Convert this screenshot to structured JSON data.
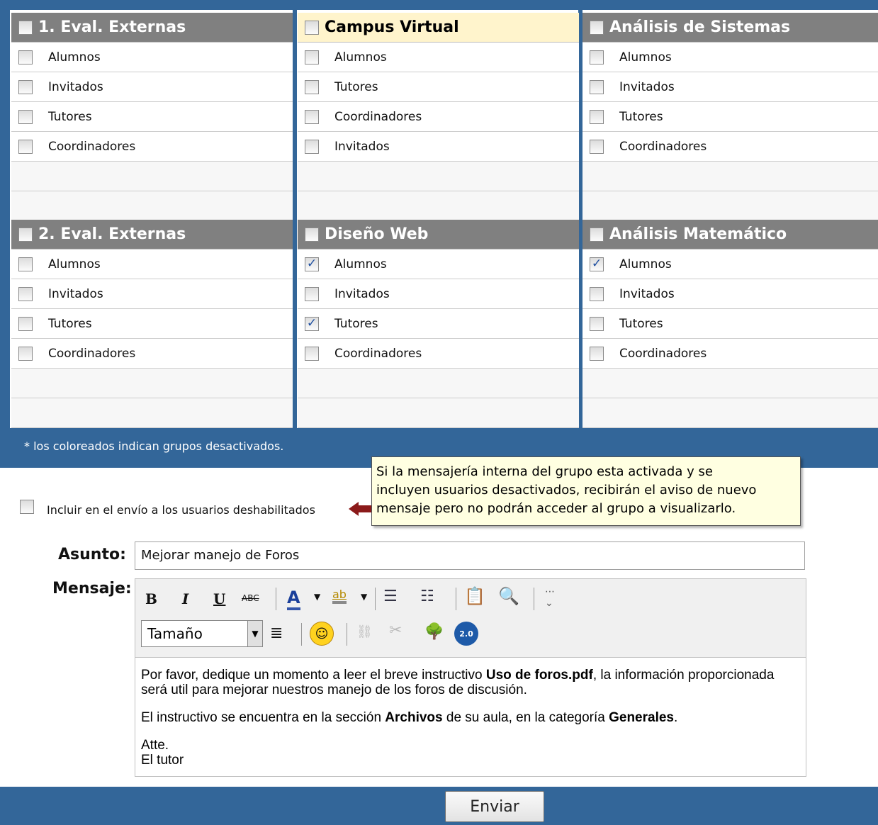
{
  "groups": [
    {
      "title": "1. Eval. Externas",
      "highlight": false,
      "items": [
        {
          "label": "Alumnos",
          "checked": false
        },
        {
          "label": "Invitados",
          "checked": false
        },
        {
          "label": "Tutores",
          "checked": false
        },
        {
          "label": "Coordinadores",
          "checked": false
        }
      ]
    },
    {
      "title": "Campus Virtual",
      "highlight": true,
      "items": [
        {
          "label": "Alumnos",
          "checked": false
        },
        {
          "label": "Tutores",
          "checked": false
        },
        {
          "label": "Coordinadores",
          "checked": false
        },
        {
          "label": "Invitados",
          "checked": false
        }
      ]
    },
    {
      "title": "Análisis de Sistemas",
      "highlight": false,
      "items": [
        {
          "label": "Alumnos",
          "checked": false
        },
        {
          "label": "Invitados",
          "checked": false
        },
        {
          "label": "Tutores",
          "checked": false
        },
        {
          "label": "Coordinadores",
          "checked": false
        }
      ]
    },
    {
      "title": "2. Eval. Externas",
      "highlight": false,
      "items": [
        {
          "label": "Alumnos",
          "checked": false
        },
        {
          "label": "Invitados",
          "checked": false
        },
        {
          "label": "Tutores",
          "checked": false
        },
        {
          "label": "Coordinadores",
          "checked": false
        }
      ]
    },
    {
      "title": "Diseño Web",
      "highlight": false,
      "items": [
        {
          "label": "Alumnos",
          "checked": true
        },
        {
          "label": "Invitados",
          "checked": false
        },
        {
          "label": "Tutores",
          "checked": true
        },
        {
          "label": "Coordinadores",
          "checked": false
        }
      ]
    },
    {
      "title": "Análisis Matemático",
      "highlight": false,
      "items": [
        {
          "label": "Alumnos",
          "checked": true
        },
        {
          "label": "Invitados",
          "checked": false
        },
        {
          "label": "Tutores",
          "checked": false
        },
        {
          "label": "Coordinadores",
          "checked": false
        }
      ]
    }
  ],
  "note": "* los coloreados indican grupos desactivados.",
  "include_disabled": {
    "label": "Incluir en el envío a los usuarios deshabilitados",
    "checked": false
  },
  "tooltip": {
    "line1": "Si la mensajería interna del grupo esta activada y se",
    "line2": "incluyen usuarios desactivados, recibirán el aviso de nuevo",
    "line3": "mensaje pero no podrán acceder al grupo a visualizarlo."
  },
  "form": {
    "subject_label": "Asunto:",
    "subject_value": "Mejorar manejo de Foros",
    "message_label": "Mensaje:",
    "size_select": "Tamaño"
  },
  "toolbar": {
    "bold": "B",
    "italic": "I",
    "underline": "U",
    "strike": "ABC",
    "font_color": "A",
    "highlight": "ab"
  },
  "message": {
    "p1_a": "Por favor, dedique un momento a leer el breve instructivo ",
    "p1_b": "Uso de foros.pdf",
    "p1_c": ", la información proporcionada será util para mejorar nuestros manejo de los foros de discusión.",
    "p2_a": "El instructivo se encuentra en la sección ",
    "p2_b": "Archivos",
    "p2_c": " de su aula, en la categoría ",
    "p2_d": "Generales",
    "p2_e": ".",
    "sign1": "Atte.",
    "sign2": "El tutor"
  },
  "send_label": "Enviar",
  "colors": {
    "bar": "#336699",
    "header_gray": "#808080",
    "header_highlight": "#fff4cc",
    "tooltip_bg": "#ffffe1"
  }
}
